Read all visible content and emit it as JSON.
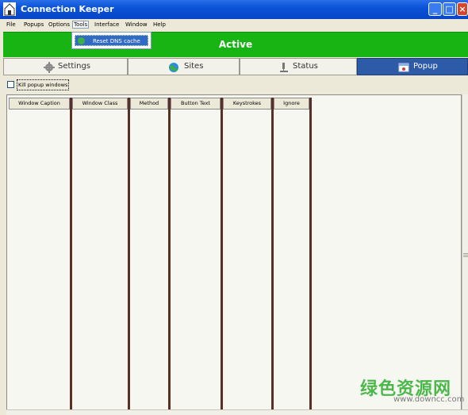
{
  "window": {
    "title": "Connection Keeper"
  },
  "menu": [
    "File",
    "Popups",
    "Options",
    "Tools",
    "Interface",
    "Window",
    "Help"
  ],
  "tools_menu": {
    "items": [
      "Reset DNS cache"
    ]
  },
  "status": {
    "text": "Active",
    "color": "#17B413"
  },
  "tabs": [
    {
      "label": "Settings",
      "icon": "gear-icon"
    },
    {
      "label": "Sites",
      "icon": "globe-icon"
    },
    {
      "label": "Status",
      "icon": "microscope-icon"
    },
    {
      "label": "Popup",
      "icon": "popup-icon",
      "selected": true
    }
  ],
  "kill_popups": {
    "label": "Kill popup windows",
    "checked": false
  },
  "columns": [
    "Window Caption",
    "Window Class",
    "Method",
    "Button Text",
    "Keystrokes",
    "Ignore"
  ],
  "watermark": {
    "text": "绿色资源网",
    "url": "www.downcc.com"
  }
}
